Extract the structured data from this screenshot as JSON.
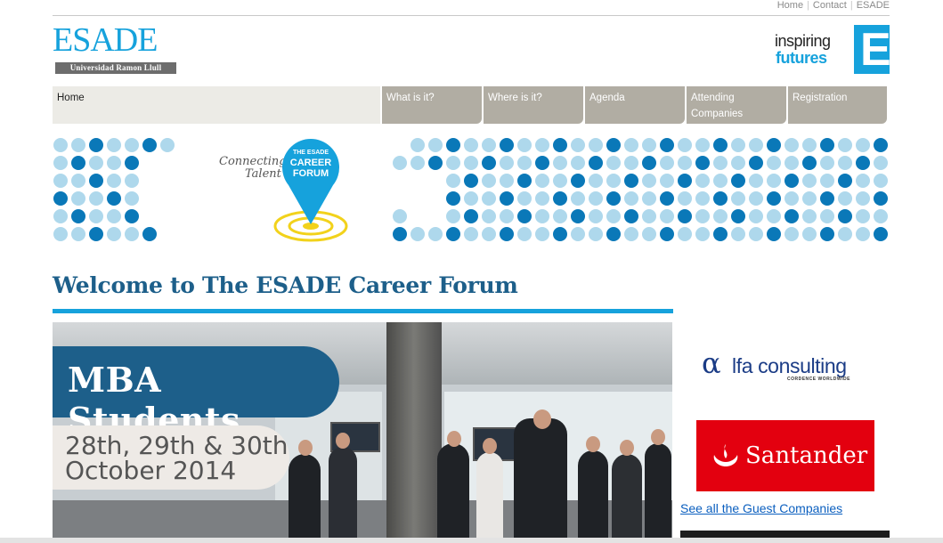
{
  "top_links": [
    "Home",
    "Contact",
    "ESADE"
  ],
  "logo": {
    "name": "ESADE",
    "subtitle": "Universidad Ramon Llull"
  },
  "tagline": {
    "line1": "inspiring",
    "line2": "futures",
    "mark": "E"
  },
  "nav": [
    {
      "label": "Home"
    },
    {
      "label": "What is it?"
    },
    {
      "label": "Where is it?"
    },
    {
      "label": "Agenda"
    },
    {
      "label": "Attending Companies"
    },
    {
      "label": "Registration"
    }
  ],
  "banner": {
    "slogan_line1": "Connecting",
    "slogan_line2": "Talent",
    "badge_line1": "THE ESADE",
    "badge_line2": "CAREER",
    "badge_line3": "FORUM"
  },
  "welcome_title": "Welcome to The ESADE Career Forum",
  "hero": {
    "headline": "MBA Students",
    "dates_line1": "28th, 29th & 30th",
    "dates_line2": "October 2014"
  },
  "sponsors": {
    "alfa_mark": "α",
    "alfa_name": "lfa consulting",
    "alfa_sub": "CORDENCE WORLDWIDE",
    "santander_name": "Santander"
  },
  "see_all_link": "See all the Guest Companies",
  "colors": {
    "accent": "#16a2dc",
    "navy": "#1d5f8a",
    "nav_tab": "#b1ada3",
    "santander_red": "#e3000f"
  }
}
